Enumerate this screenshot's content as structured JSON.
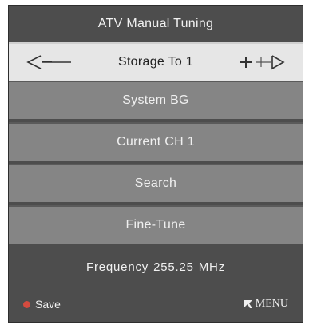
{
  "title": "ATV Manual Tuning",
  "items": [
    {
      "label": "Storage To 1"
    },
    {
      "label": "System BG"
    },
    {
      "label": "Current CH 1"
    },
    {
      "label": "Search"
    },
    {
      "label": "Fine-Tune"
    }
  ],
  "frequency": {
    "label": "Frequency",
    "value": "255.25",
    "unit": "MHz"
  },
  "footer": {
    "save_label": "Save",
    "menu_label": "MENU"
  },
  "icons": {
    "left": "minus-arrow-left-icon",
    "right": "plus-arrow-right-icon",
    "save": "red-dot-icon",
    "menu": "menu-return-icon"
  },
  "colors": {
    "panel": "#4d4d4d",
    "row": "#858585",
    "selected": "#e6e6e6",
    "save_dot": "#d44b3f"
  }
}
